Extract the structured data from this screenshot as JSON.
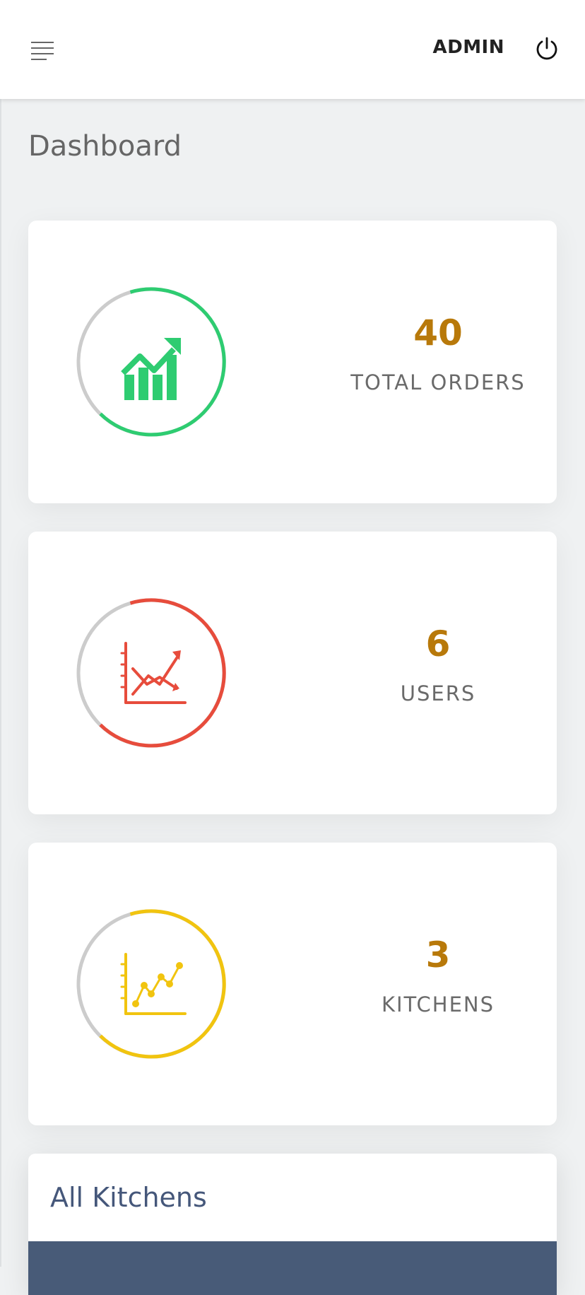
{
  "header": {
    "user_label": "ADMIN",
    "menu_icon": "hamburger-menu-icon",
    "power_icon": "power-icon"
  },
  "page": {
    "title": "Dashboard"
  },
  "stats": [
    {
      "value": "40",
      "label": "TOTAL ORDERS",
      "color": "#2ecc71",
      "icon": "bar-chart-trend-icon"
    },
    {
      "value": "6",
      "label": "USERS",
      "color": "#e74c3c",
      "icon": "line-chart-icon"
    },
    {
      "value": "3",
      "label": "KITCHENS",
      "color": "#f1c40f",
      "icon": "scatter-line-chart-icon"
    }
  ],
  "section": {
    "title": "All Kitchens"
  },
  "colors": {
    "value_text": "#b8790a",
    "section_title": "#45577a",
    "table_header": "#485b78",
    "ring_track": "#cccccc"
  }
}
